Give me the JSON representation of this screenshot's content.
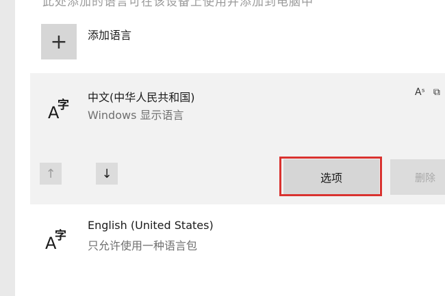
{
  "header": {
    "cut_text": "此处添加的语言可在该设备上使用并添加到电脑中"
  },
  "add_language": {
    "icon_text": "+",
    "label": "添加语言"
  },
  "languages": [
    {
      "glyph_a": "A",
      "glyph_zi": "字",
      "name": "中文(中华人民共和国)",
      "subtitle": "Windows 显示语言",
      "feature_icons": [
        "text-to-speech-icon",
        "display-language-icon",
        "speech-recognition-icon"
      ]
    },
    {
      "glyph_a": "A",
      "glyph_zi": "字",
      "name": "English (United States)",
      "subtitle": "只允许使用一种语言包"
    }
  ],
  "actions": {
    "move_up": "↑",
    "move_down": "↓",
    "options": "选项",
    "remove": "删除"
  },
  "colors": {
    "highlight_border": "#d9322f",
    "selected_background": "#f2f2f2"
  }
}
